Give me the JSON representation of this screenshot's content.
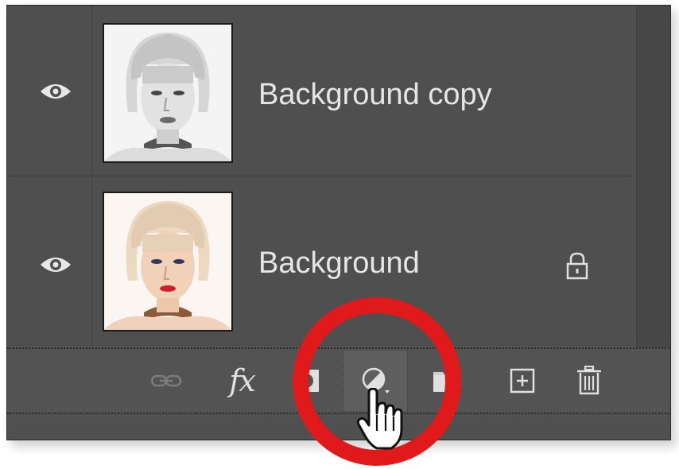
{
  "panel": {
    "name": "Layers panel",
    "layers": [
      {
        "name": "Background copy",
        "visible": true,
        "locked": false,
        "thumbnail": "grayscale-portrait"
      },
      {
        "name": "Background",
        "visible": true,
        "locked": true,
        "thumbnail": "color-portrait"
      }
    ]
  },
  "toolbar": {
    "buttons": [
      {
        "id": "link",
        "icon": "link-icon"
      },
      {
        "id": "fx",
        "label": "fx",
        "icon": "fx-icon"
      },
      {
        "id": "mask",
        "icon": "layer-mask-icon"
      },
      {
        "id": "adjustment",
        "icon": "adjustment-layer-icon",
        "highlighted": true
      },
      {
        "id": "group",
        "icon": "folder-icon"
      },
      {
        "id": "new-layer",
        "icon": "new-layer-icon"
      },
      {
        "id": "delete",
        "icon": "trash-icon"
      }
    ]
  },
  "annotation": {
    "color": "#e01a1a",
    "target": "adjustment"
  },
  "colors": {
    "panel_bg": "#535353",
    "row_bg": "#4f4f4f",
    "text": "#e6e6e6"
  }
}
